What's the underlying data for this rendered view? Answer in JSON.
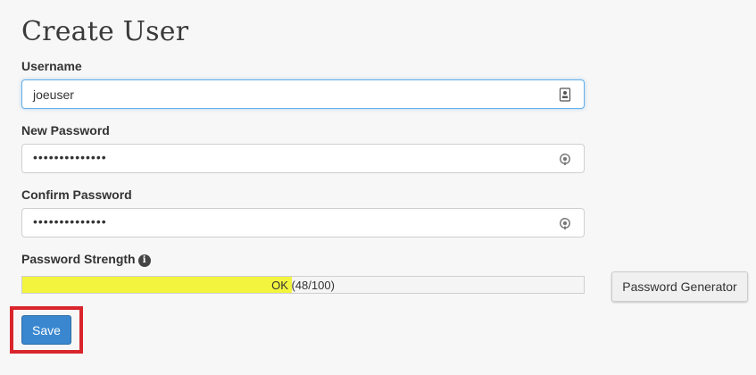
{
  "page": {
    "title": "Create User"
  },
  "form": {
    "username": {
      "label": "Username",
      "value": "joeuser",
      "icon": "contact-card-icon"
    },
    "new_password": {
      "label": "New Password",
      "masked_value": "••••••••••••••",
      "icon": "password-reveal-icon"
    },
    "confirm_password": {
      "label": "Confirm Password",
      "masked_value": "••••••••••••••",
      "icon": "password-reveal-icon"
    },
    "strength": {
      "label": "Password Strength",
      "info_icon": "i",
      "text": "OK (48/100)",
      "score": 48,
      "max": 100,
      "color": "#f2f43e"
    },
    "generator_button": "Password Generator",
    "save_button": "Save"
  },
  "colors": {
    "primary": "#3a87d0",
    "highlight": "#d9252b"
  }
}
